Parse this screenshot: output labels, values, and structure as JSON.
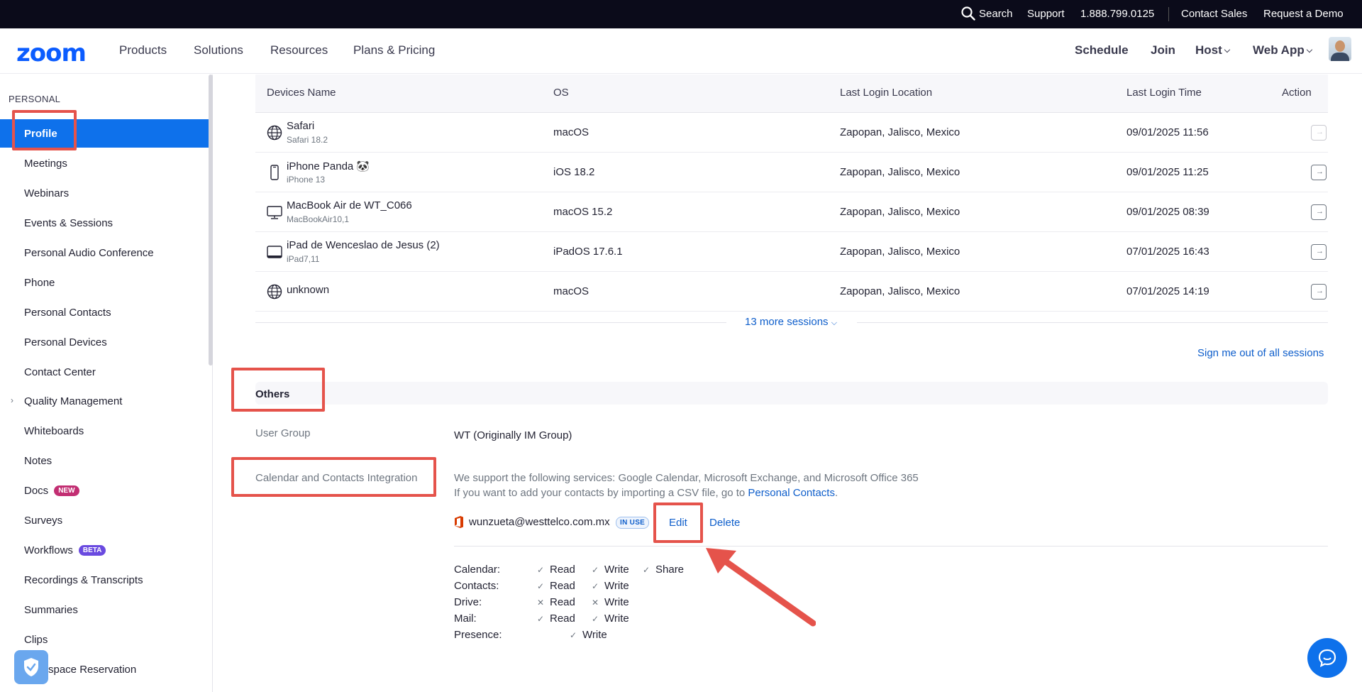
{
  "topbar": {
    "search": "Search",
    "support": "Support",
    "phone": "1.888.799.0125",
    "contact_sales": "Contact Sales",
    "request_demo": "Request a Demo"
  },
  "nav": {
    "logo": "zoom",
    "products": "Products",
    "solutions": "Solutions",
    "resources": "Resources",
    "plans": "Plans & Pricing",
    "schedule": "Schedule",
    "join": "Join",
    "host": "Host",
    "webapp": "Web App"
  },
  "sidebar": {
    "section": "PERSONAL",
    "items": [
      {
        "label": "Profile"
      },
      {
        "label": "Meetings"
      },
      {
        "label": "Webinars"
      },
      {
        "label": "Events & Sessions"
      },
      {
        "label": "Personal Audio Conference"
      },
      {
        "label": "Phone"
      },
      {
        "label": "Personal Contacts"
      },
      {
        "label": "Personal Devices"
      },
      {
        "label": "Contact Center"
      },
      {
        "label": "Quality Management"
      },
      {
        "label": "Whiteboards"
      },
      {
        "label": "Notes"
      },
      {
        "label": "Docs",
        "badge": "NEW"
      },
      {
        "label": "Surveys"
      },
      {
        "label": "Workflows",
        "badge": "BETA"
      },
      {
        "label": "Recordings & Transcripts"
      },
      {
        "label": "Summaries"
      },
      {
        "label": "Clips"
      },
      {
        "label": "space Reservation"
      }
    ]
  },
  "sessions": {
    "headers": {
      "device": "Devices Name",
      "os": "OS",
      "location": "Last Login Location",
      "time": "Last Login Time",
      "action": "Action"
    },
    "rows": [
      {
        "name": "Safari",
        "sub": "Safari 18.2",
        "os": "macOS",
        "location": "Zapopan, Jalisco, Mexico",
        "time": "09/01/2025 11:56",
        "icon": "globe-icon"
      },
      {
        "name": "iPhone Panda 🐼",
        "sub": "iPhone 13",
        "os": "iOS 18.2",
        "location": "Zapopan, Jalisco, Mexico",
        "time": "09/01/2025 11:25",
        "icon": "phone-icon"
      },
      {
        "name": "MacBook Air de WT_C066",
        "sub": "MacBookAir10,1",
        "os": "macOS 15.2",
        "location": "Zapopan, Jalisco, Mexico",
        "time": "09/01/2025 08:39",
        "icon": "monitor-icon"
      },
      {
        "name": "iPad de Wenceslao de Jesus (2)",
        "sub": "iPad7,11",
        "os": "iPadOS 17.6.1",
        "location": "Zapopan, Jalisco, Mexico",
        "time": "07/01/2025 16:43",
        "icon": "tablet-icon"
      },
      {
        "name": "unknown",
        "sub": "",
        "os": "macOS",
        "location": "Zapopan, Jalisco, Mexico",
        "time": "07/01/2025 14:19",
        "icon": "globe-icon"
      }
    ],
    "more": "13 more sessions",
    "signout_all": "Sign me out of all sessions"
  },
  "others": {
    "title": "Others",
    "user_group_label": "User Group",
    "user_group_value": "WT (Originally IM Group)",
    "calendar_label": "Calendar and Contacts Integration",
    "calendar_desc1": "We support the following services: Google Calendar, Microsoft Exchange, and Microsoft Office 365",
    "calendar_desc2_prefix": "If you want to add your contacts by importing a CSV file, go to",
    "calendar_desc2_link": "Personal Contacts",
    "calendar_desc2_suffix": ".",
    "email": "wunzueta@westtelco.com.mx",
    "in_use": "IN USE",
    "edit": "Edit",
    "delete": "Delete",
    "permissions": [
      {
        "label": "Calendar:",
        "read": "Read",
        "write": "Write",
        "share": "Share"
      },
      {
        "label": "Contacts:",
        "read": "Read",
        "write": "Write"
      },
      {
        "label": "Drive:",
        "read": "Read",
        "write": "Write"
      },
      {
        "label": "Mail:",
        "read": "Read",
        "write": "Write"
      },
      {
        "label": "Presence:",
        "write": "Write"
      }
    ]
  },
  "colors": {
    "brand": "#0b5cff",
    "active": "#0e71eb",
    "link": "#0e5ecb",
    "annotation": "#e5534b"
  }
}
